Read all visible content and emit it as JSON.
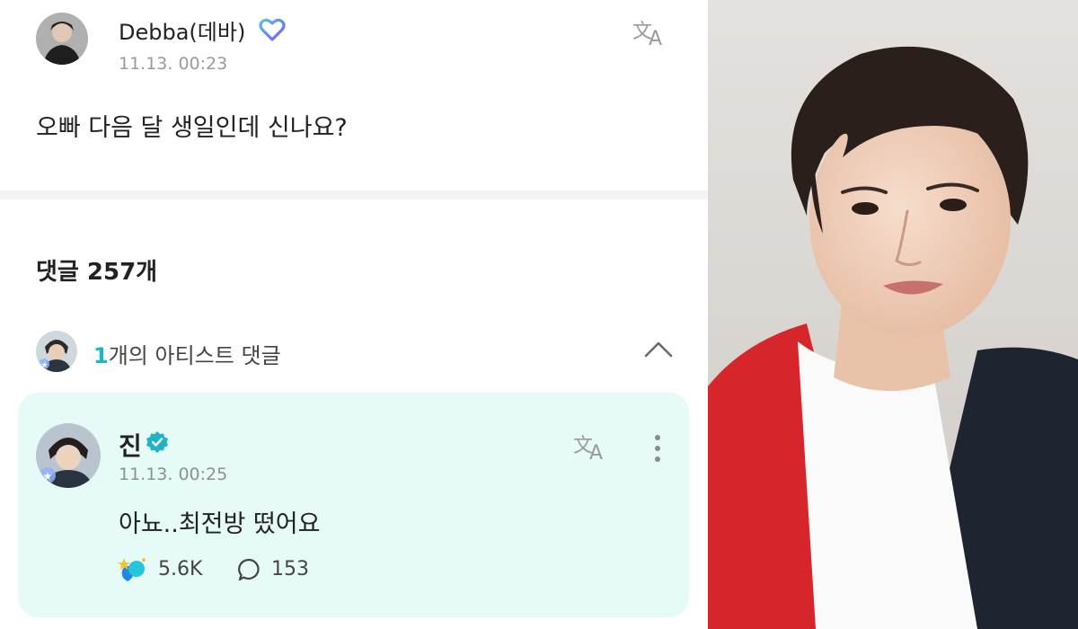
{
  "post": {
    "author": "Debba(데바)",
    "time": "11.13. 00:23",
    "body": "오빠 다음 달 생일인데 신나요?",
    "avatar_icon": "user-avatar",
    "translate_icon": "translate-icon",
    "badge_icon": "heart-badge-icon"
  },
  "comments": {
    "title": "댓글 257개"
  },
  "artist_comments": {
    "count": "1",
    "label": "개의 아티스트 댓글",
    "toggle_icon": "chevron-up-icon"
  },
  "artist_comment": {
    "name": "진",
    "verified_icon": "verified-badge-icon",
    "time": "11.13. 00:25",
    "body": "아뇨..최전방 떴어요",
    "likes": "5.6K",
    "replies": "153",
    "card_color": "#e6fbf8"
  },
  "colors": {
    "accent": "#19b8c2",
    "heart": "#6b63e0",
    "verified": "#1fb3c8"
  }
}
